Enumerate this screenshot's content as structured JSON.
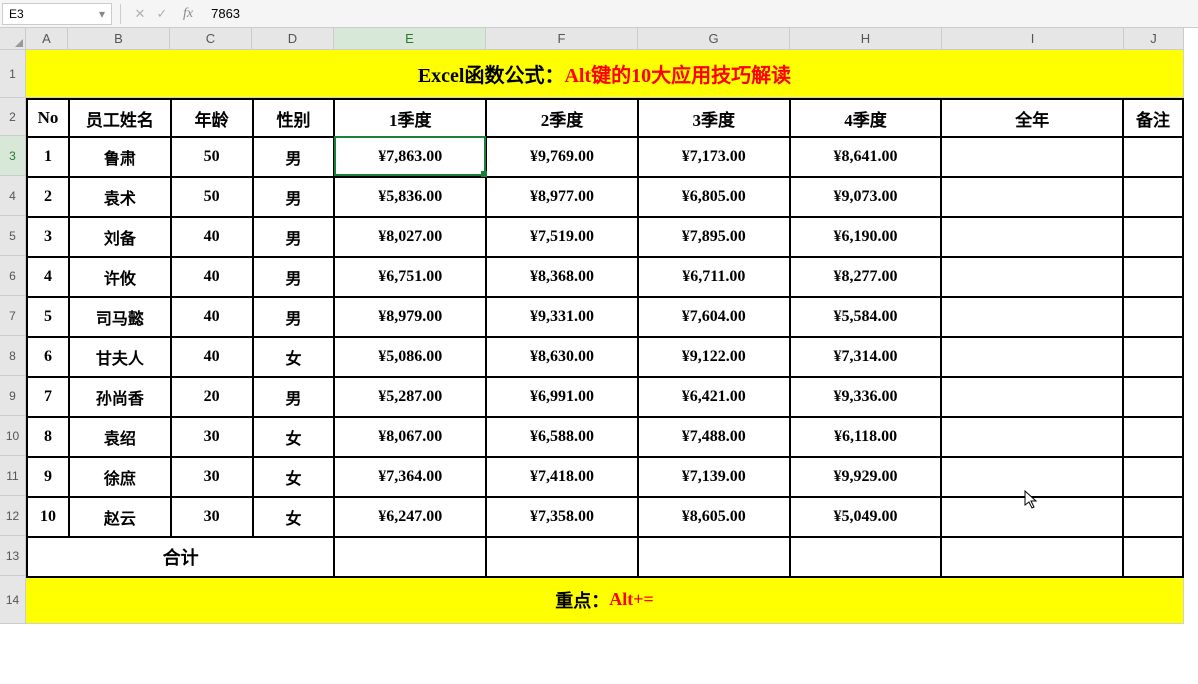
{
  "formula_bar": {
    "cell_ref": "E3",
    "value": "7863"
  },
  "columns": [
    "A",
    "B",
    "C",
    "D",
    "E",
    "F",
    "G",
    "H",
    "I",
    "J"
  ],
  "active_col": "E",
  "active_row": 3,
  "title": {
    "prefix": "Excel函数公式：",
    "suffix": "Alt键的10大应用技巧解读"
  },
  "headers": [
    "No",
    "员工姓名",
    "年龄",
    "性别",
    "1季度",
    "2季度",
    "3季度",
    "4季度",
    "全年",
    "备注"
  ],
  "rows": [
    {
      "no": "1",
      "name": "鲁肃",
      "age": "50",
      "gender": "男",
      "q1": "¥7,863.00",
      "q2": "¥9,769.00",
      "q3": "¥7,173.00",
      "q4": "¥8,641.00",
      "year": "",
      "note": ""
    },
    {
      "no": "2",
      "name": "袁术",
      "age": "50",
      "gender": "男",
      "q1": "¥5,836.00",
      "q2": "¥8,977.00",
      "q3": "¥6,805.00",
      "q4": "¥9,073.00",
      "year": "",
      "note": ""
    },
    {
      "no": "3",
      "name": "刘备",
      "age": "40",
      "gender": "男",
      "q1": "¥8,027.00",
      "q2": "¥7,519.00",
      "q3": "¥7,895.00",
      "q4": "¥6,190.00",
      "year": "",
      "note": ""
    },
    {
      "no": "4",
      "name": "许攸",
      "age": "40",
      "gender": "男",
      "q1": "¥6,751.00",
      "q2": "¥8,368.00",
      "q3": "¥6,711.00",
      "q4": "¥8,277.00",
      "year": "",
      "note": ""
    },
    {
      "no": "5",
      "name": "司马懿",
      "age": "40",
      "gender": "男",
      "q1": "¥8,979.00",
      "q2": "¥9,331.00",
      "q3": "¥7,604.00",
      "q4": "¥5,584.00",
      "year": "",
      "note": ""
    },
    {
      "no": "6",
      "name": "甘夫人",
      "age": "40",
      "gender": "女",
      "q1": "¥5,086.00",
      "q2": "¥8,630.00",
      "q3": "¥9,122.00",
      "q4": "¥7,314.00",
      "year": "",
      "note": ""
    },
    {
      "no": "7",
      "name": "孙尚香",
      "age": "20",
      "gender": "男",
      "q1": "¥5,287.00",
      "q2": "¥6,991.00",
      "q3": "¥6,421.00",
      "q4": "¥9,336.00",
      "year": "",
      "note": ""
    },
    {
      "no": "8",
      "name": "袁绍",
      "age": "30",
      "gender": "女",
      "q1": "¥8,067.00",
      "q2": "¥6,588.00",
      "q3": "¥7,488.00",
      "q4": "¥6,118.00",
      "year": "",
      "note": ""
    },
    {
      "no": "9",
      "name": "徐庶",
      "age": "30",
      "gender": "女",
      "q1": "¥7,364.00",
      "q2": "¥7,418.00",
      "q3": "¥7,139.00",
      "q4": "¥9,929.00",
      "year": "",
      "note": ""
    },
    {
      "no": "10",
      "name": "赵云",
      "age": "30",
      "gender": "女",
      "q1": "¥6,247.00",
      "q2": "¥7,358.00",
      "q3": "¥8,605.00",
      "q4": "¥5,049.00",
      "year": "",
      "note": ""
    }
  ],
  "total_label": "合计",
  "footer": {
    "prefix": "重点：",
    "suffix": "Alt+="
  },
  "chart_data": {
    "type": "table",
    "title": "Excel函数公式：Alt键的10大应用技巧解读",
    "columns": [
      "No",
      "员工姓名",
      "年龄",
      "性别",
      "1季度",
      "2季度",
      "3季度",
      "4季度"
    ],
    "data": [
      [
        1,
        "鲁肃",
        50,
        "男",
        7863,
        9769,
        7173,
        8641
      ],
      [
        2,
        "袁术",
        50,
        "男",
        5836,
        8977,
        6805,
        9073
      ],
      [
        3,
        "刘备",
        40,
        "男",
        8027,
        7519,
        7895,
        6190
      ],
      [
        4,
        "许攸",
        40,
        "男",
        6751,
        8368,
        6711,
        8277
      ],
      [
        5,
        "司马懿",
        40,
        "男",
        8979,
        9331,
        7604,
        5584
      ],
      [
        6,
        "甘夫人",
        40,
        "女",
        5086,
        8630,
        9122,
        7314
      ],
      [
        7,
        "孙尚香",
        20,
        "男",
        5287,
        6991,
        6421,
        9336
      ],
      [
        8,
        "袁绍",
        30,
        "女",
        8067,
        6588,
        7488,
        6118
      ],
      [
        9,
        "徐庶",
        30,
        "女",
        7364,
        7418,
        7139,
        9929
      ],
      [
        10,
        "赵云",
        30,
        "女",
        6247,
        7358,
        8605,
        5049
      ]
    ]
  }
}
